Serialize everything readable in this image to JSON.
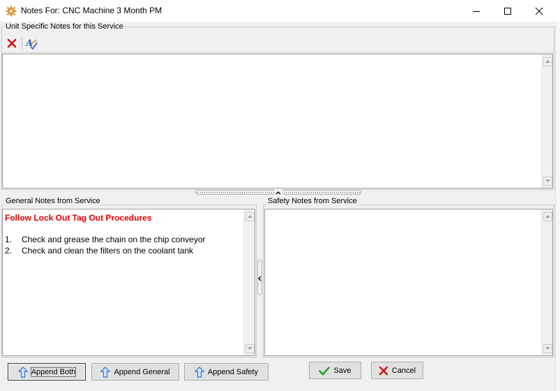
{
  "window": {
    "title": "Notes For: CNC Machine 3 Month PM"
  },
  "unit_notes": {
    "label": "Unit Specific Notes for this Service",
    "toolbar": {
      "delete_icon": "red-x-icon",
      "spellcheck_icon": "spellcheck-icon"
    },
    "content": ""
  },
  "general_notes": {
    "label": "General Notes from Service",
    "heading": "Follow Lock Out Tag Out Procedures",
    "items": [
      {
        "num": "1.",
        "text": "Check and grease the chain on the chip conveyor"
      },
      {
        "num": "2.",
        "text": "Check and clean the filters on the coolant tank"
      }
    ]
  },
  "safety_notes": {
    "label": "Safety Notes from Service",
    "content": ""
  },
  "buttons": {
    "append_both": "Append Both",
    "append_general": "Append General",
    "append_safety": "Append Safety",
    "save": "Save",
    "cancel": "Cancel"
  },
  "colors": {
    "heading_red": "#e00000",
    "arrow_blue": "#2f6fd0",
    "check_green": "#1a9e1a",
    "x_red": "#d01010"
  }
}
